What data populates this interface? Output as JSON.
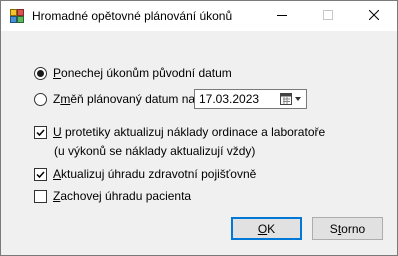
{
  "window": {
    "title": "Hromadné opětovné plánování úkonů",
    "controls": {
      "minimize_icon": "minimize-icon",
      "maximize_icon": "maximize-icon",
      "close_icon": "close-icon"
    }
  },
  "options": {
    "keep_date": {
      "accel": "P",
      "rest": "onechej úkonům původní datum",
      "selected": true
    },
    "change_date": {
      "pre": "Z",
      "accel": "m",
      "rest": "ěň plánovaný datum na:",
      "selected": false
    },
    "date_value": "17.03.2023",
    "calendar_icon": "calendar-dropdown-icon"
  },
  "checkboxes": {
    "update_costs": {
      "accel": "U",
      "rest": " protetiky aktualizuj náklady ordinace a laboratoře",
      "checked": true
    },
    "update_costs_note": "(u výkonů se náklady aktualizují vždy)",
    "update_insurance": {
      "accel": "A",
      "rest": "ktualizuj úhradu zdravotní pojišťovně",
      "checked": true
    },
    "keep_patient_payment": {
      "accel": "Z",
      "rest": "achovej úhradu pacienta",
      "checked": false
    }
  },
  "buttons": {
    "ok": {
      "accel": "O",
      "rest": "K"
    },
    "cancel": {
      "pre": "S",
      "accel": "t",
      "rest": "orno"
    }
  },
  "colors": {
    "accent": "#0078d7",
    "background": "#f0f0f0",
    "titlebar": "#ffffff"
  }
}
